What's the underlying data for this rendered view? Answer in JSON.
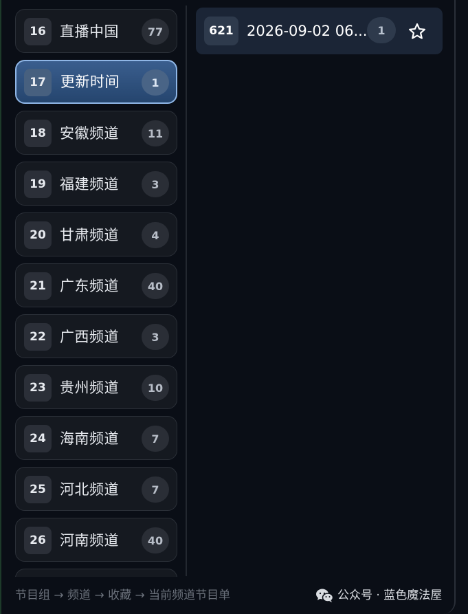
{
  "groups": [
    {
      "num": "16",
      "label": "直播中国",
      "count": "77"
    },
    {
      "num": "17",
      "label": "更新时间",
      "count": "1",
      "active": true
    },
    {
      "num": "18",
      "label": "安徽频道",
      "count": "11"
    },
    {
      "num": "19",
      "label": "福建频道",
      "count": "3"
    },
    {
      "num": "20",
      "label": "甘肃频道",
      "count": "4"
    },
    {
      "num": "21",
      "label": "广东频道",
      "count": "40"
    },
    {
      "num": "22",
      "label": "广西频道",
      "count": "3"
    },
    {
      "num": "23",
      "label": "贵州频道",
      "count": "10"
    },
    {
      "num": "24",
      "label": "海南频道",
      "count": "7"
    },
    {
      "num": "25",
      "label": "河北频道",
      "count": "7"
    },
    {
      "num": "26",
      "label": "河南频道",
      "count": "40"
    }
  ],
  "program": {
    "num": "621",
    "time": "2026-09-02 06...",
    "count": "1",
    "favorite_icon": "star-outline-icon"
  },
  "footer": {
    "hint": "节目组 → 频道 → 收藏 → 当前频道节目单"
  },
  "watermark": {
    "text": "公众号 · 蓝色魔法屋",
    "icon": "wechat-icon"
  },
  "colors": {
    "active_bg": "#2e4f7c",
    "active_border": "#8fb6e6",
    "panel_bg": "#0a0e16"
  }
}
